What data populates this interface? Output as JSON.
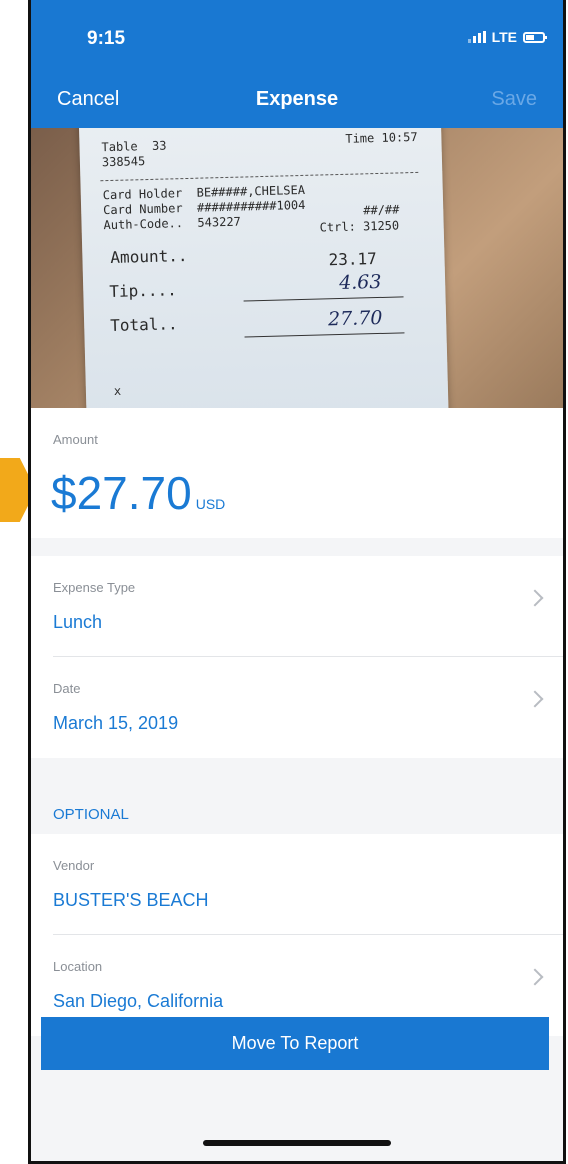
{
  "status": {
    "time": "9:15",
    "network": "LTE"
  },
  "nav": {
    "cancel": "Cancel",
    "title": "Expense",
    "save": "Save"
  },
  "receipt": {
    "table": "Table  33",
    "code": "338545",
    "time": "Time 10:57",
    "card_holder": "Card Holder  BE#####,CHELSEA",
    "card_number": "Card Number  ###########1004",
    "auth_code": "Auth-Code..  543227",
    "expiry": "##/##",
    "ctrl": "Ctrl: 31250",
    "amount_label": "Amount..",
    "amount_value": "23.17",
    "tip_label": "Tip....",
    "tip_value": "4.63",
    "total_label": "Total..",
    "total_value": "27.70",
    "signature_mark": "x"
  },
  "amount": {
    "label": "Amount",
    "value": "$27.70",
    "currency": "USD"
  },
  "expense_type": {
    "label": "Expense Type",
    "value": "Lunch"
  },
  "date": {
    "label": "Date",
    "value": "March 15, 2019"
  },
  "optional": {
    "label": "OPTIONAL"
  },
  "vendor": {
    "label": "Vendor",
    "value": "BUSTER'S BEACH"
  },
  "location": {
    "label": "Location",
    "value": "San Diego, California"
  },
  "actions": {
    "move_to_report": "Move To Report"
  },
  "colors": {
    "primary": "#1978d2",
    "accent_text": "#1a7ad4",
    "pointer": "#f2a91a"
  }
}
